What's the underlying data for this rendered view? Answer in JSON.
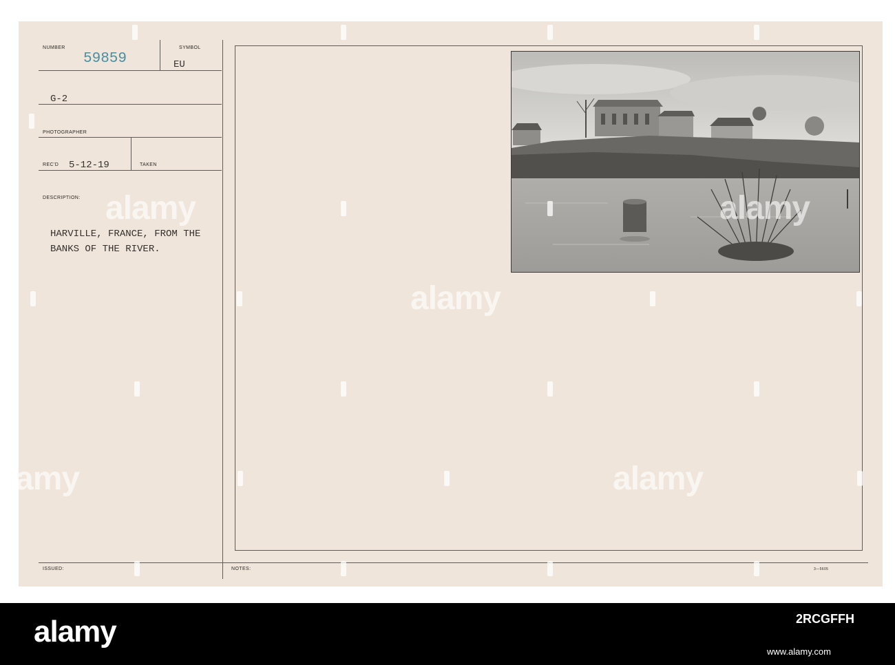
{
  "card": {
    "number_label": "NUMBER",
    "number_value": "59859",
    "symbol_label": "SYMBOL",
    "symbol_value": "EU",
    "section_value": "G-2",
    "photographer_label": "PHOTOGRAPHER",
    "recd_label": "REC'D",
    "recd_value": "5-12-19",
    "taken_label": "TAKEN",
    "description_label": "DESCRIPTION:",
    "description_line1": "HARVILLE, FRANCE, FROM THE",
    "description_line2": "BANKS OF THE RIVER.",
    "issued_label": "ISSUED:",
    "notes_label": "NOTES:",
    "form_code": "3—5605"
  },
  "watermark": "alamy",
  "footer": {
    "logo": "alamy",
    "image_id": "2RCGFFH",
    "url": "www.alamy.com"
  },
  "colors": {
    "card_paper": "#efe5da",
    "number_ink": "#4a8fa0",
    "rule_lines": "#5f5a55",
    "footer_bg": "#000000"
  }
}
